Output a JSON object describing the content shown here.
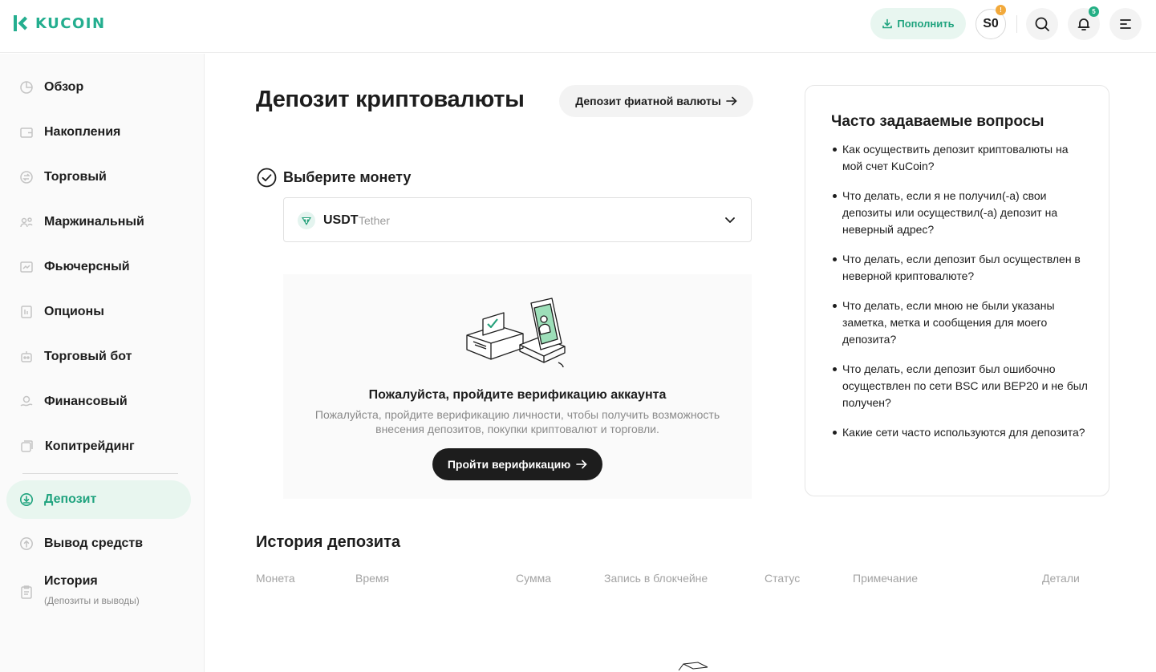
{
  "header": {
    "logo_text": "KUCOIN",
    "topup_label": "Пополнить",
    "avatar_initials": "S0",
    "avatar_badge": "!",
    "notifications_badge": "5"
  },
  "sidebar": {
    "items": [
      {
        "label": "Обзор"
      },
      {
        "label": "Накопления"
      },
      {
        "label": "Торговый"
      },
      {
        "label": "Маржинальный"
      },
      {
        "label": "Фьючерсный"
      },
      {
        "label": "Опционы"
      },
      {
        "label": "Торговый бот"
      },
      {
        "label": "Финансовый"
      },
      {
        "label": "Копитрейдинг"
      },
      {
        "label": "Депозит"
      },
      {
        "label": "Вывод средств"
      },
      {
        "label": "История",
        "sub": "(Депозиты и выводы)"
      }
    ],
    "active_index": 9
  },
  "main": {
    "title": "Депозит криптовалюты",
    "fiat_button": "Депозит фиатной валюты",
    "step_title": "Выберите монету",
    "coin": {
      "symbol": "USDT",
      "name": "Tether"
    },
    "verify": {
      "title": "Пожалуйста, пройдите верификацию аккаунта",
      "description": "Пожалуйста, пройдите верификацию личности, чтобы получить возможность внесения депозитов, покупки криптовалют и торговли.",
      "button": "Пройти верификацию"
    },
    "history": {
      "title": "История депозита",
      "columns": [
        "Монета",
        "Время",
        "Сумма",
        "Запись в блокчейне",
        "Статус",
        "Примечание",
        "Детали"
      ]
    }
  },
  "faq": {
    "title": "Часто задаваемые вопросы",
    "items": [
      "Как осуществить депозит криптовалюты на мой счет KuCoin?",
      "Что делать, если я не получил(-а) свои депозиты или осуществил(-а) депозит на неверный адрес?",
      "Что делать, если депозит был осуществлен в неверной криптовалюте?",
      "Что делать, если мною не были указаны заметка, метка и сообщения для моего депозита?",
      "Что делать, если депозит был ошибочно осуществлен по сети BSC или BEP20 и не был получен?",
      "Какие сети часто используются для депозита?"
    ]
  },
  "colors": {
    "brand": "#24ae8f",
    "accent": "#1fa37e",
    "active_bg": "#e8f6ef",
    "dark_button": "#1d1d1d"
  },
  "icons": {
    "topup": "download-icon",
    "search": "search-icon",
    "notifications": "bell-icon",
    "menu": "menu-icon"
  }
}
